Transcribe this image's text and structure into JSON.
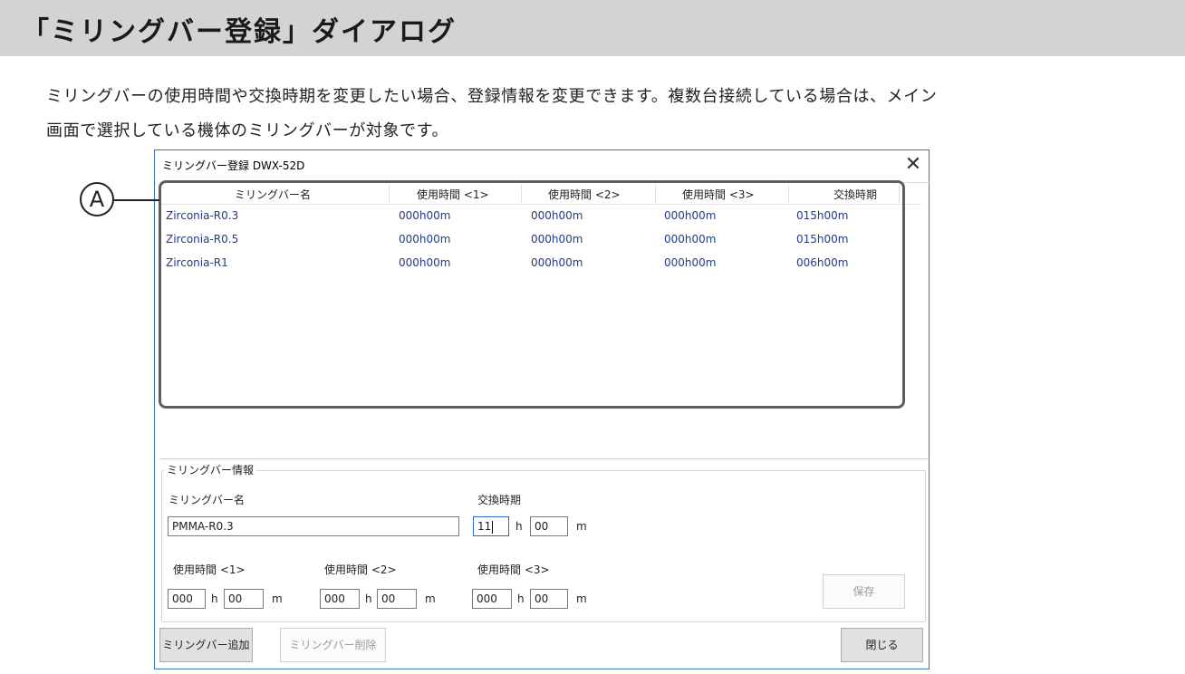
{
  "page": {
    "heading": "「ミリングバー登録」ダイアログ",
    "intro_line1": "ミリングバーの使用時間や交換時期を変更したい場合、登録情報を変更できます。複数台接続している場合は、メイン",
    "intro_line2": "画面で選択している機体のミリングバーが対象です。",
    "callout_label": "A"
  },
  "dialog": {
    "title": "ミリングバー登録 DWX-52D",
    "close_glyph": "✕",
    "list": {
      "columns": [
        "ミリングバー名",
        "使用時間 <1>",
        "使用時間 <2>",
        "使用時間 <3>",
        "交換時期"
      ],
      "rows": [
        [
          "Zirconia-R0.3",
          "000h00m",
          "000h00m",
          "000h00m",
          "015h00m"
        ],
        [
          "Zirconia-R0.5",
          "000h00m",
          "000h00m",
          "000h00m",
          "015h00m"
        ],
        [
          "Zirconia-R1",
          "000h00m",
          "000h00m",
          "000h00m",
          "006h00m"
        ]
      ]
    },
    "info": {
      "legend": "ミリングバー情報",
      "name_label": "ミリングバー名",
      "name_value": "PMMA-R0.3",
      "replace_label": "交換時期",
      "replace_h": "11",
      "replace_m": "00",
      "unit_h": "h",
      "unit_m": "m",
      "usage": [
        {
          "label": "使用時間 <1>",
          "h": "000",
          "m": "00"
        },
        {
          "label": "使用時間 <2>",
          "h": "000",
          "m": "00"
        },
        {
          "label": "使用時間 <3>",
          "h": "000",
          "m": "00"
        }
      ],
      "save_label": "保存"
    },
    "add_label": "ミリングバー追加",
    "delete_label": "ミリングバー削除",
    "close_label": "閉じる"
  }
}
